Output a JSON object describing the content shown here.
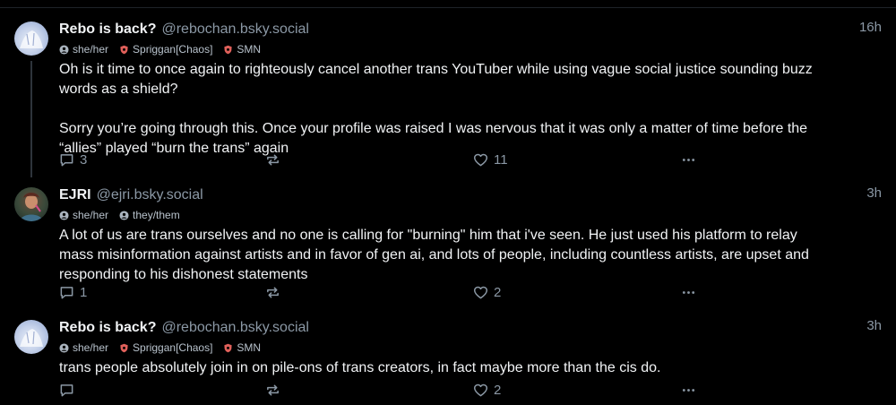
{
  "posts": [
    {
      "display_name": "Rebo is back?",
      "handle": "@rebochan.bsky.social",
      "time": "16h",
      "labels": [
        {
          "icon": "user-circle-icon",
          "text": "she/her"
        },
        {
          "icon": "shield-icon",
          "text": "Spriggan[Chaos]"
        },
        {
          "icon": "shield-icon",
          "text": "SMN"
        }
      ],
      "text": "Oh is it time to once again to righteously cancel another trans YouTuber while using vague social justice sounding buzz\nwords as a shield?\n\nSorry you’re going through this. Once your profile was raised I was nervous that it was only a matter of time before the\n“allies” played “burn the trans” again",
      "replies": "3",
      "reposts": "",
      "likes": "11"
    },
    {
      "display_name": "EJRI",
      "handle": "@ejri.bsky.social",
      "time": "3h",
      "labels": [
        {
          "icon": "user-circle-icon",
          "text": "she/her"
        },
        {
          "icon": "user-circle-icon",
          "text": "they/them"
        }
      ],
      "text": "A lot of us are trans ourselves and no one is calling for \"burning\" him that i've seen. He just used his platform to relay\nmass misinformation against artists and in favor of gen ai, and lots of people, including countless artists, are upset and\nresponding to his dishonest statements",
      "replies": "1",
      "reposts": "",
      "likes": "2"
    },
    {
      "display_name": "Rebo is back?",
      "handle": "@rebochan.bsky.social",
      "time": "3h",
      "labels": [
        {
          "icon": "user-circle-icon",
          "text": "she/her"
        },
        {
          "icon": "shield-icon",
          "text": "Spriggan[Chaos]"
        },
        {
          "icon": "shield-icon",
          "text": "SMN"
        }
      ],
      "text": "trans people absolutely join in on pile-ons of trans creators, in fact maybe more than the cis do.",
      "replies": "",
      "reposts": "",
      "likes": "2"
    }
  ],
  "colors": {
    "background": "#000000",
    "text": "#f1f3f5",
    "muted": "#8b98a5",
    "thread_line": "#2e343b",
    "label_shield": "#e0605a"
  }
}
